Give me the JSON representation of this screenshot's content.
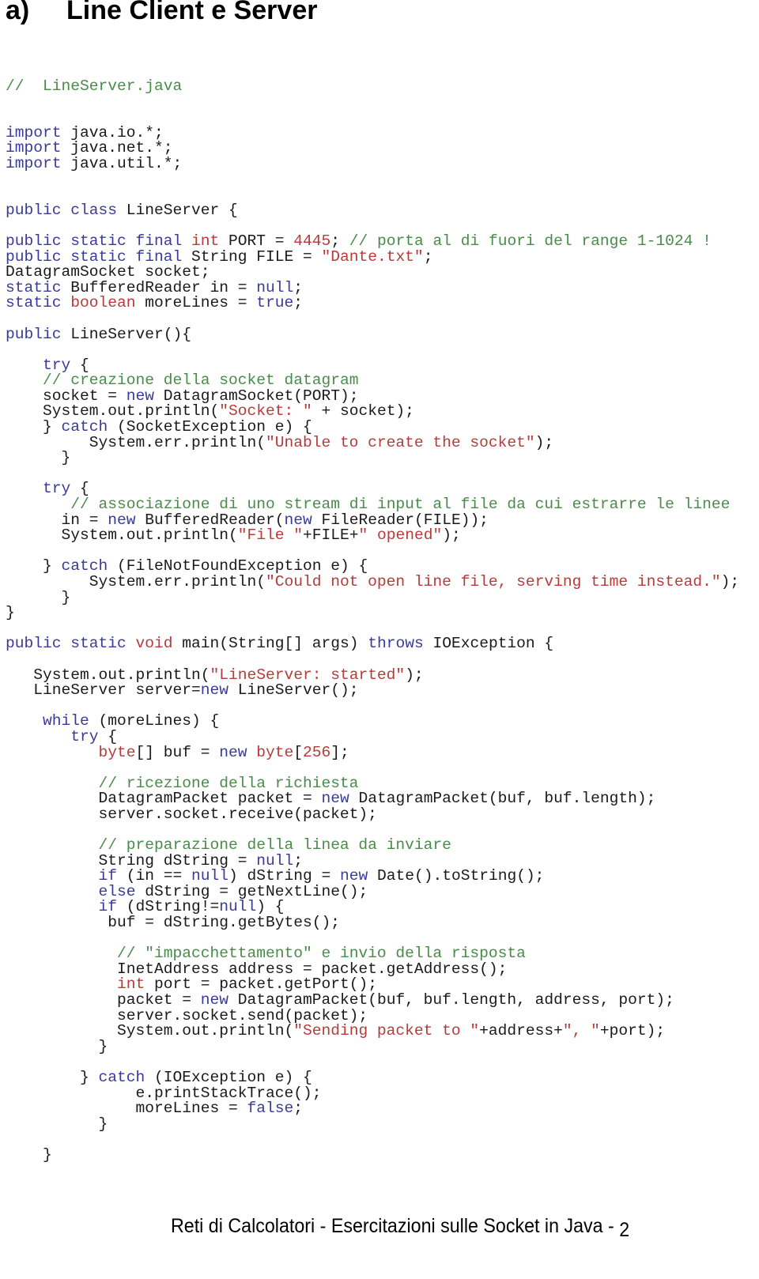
{
  "page": {
    "section_label": "a)",
    "title": "Line Client e Server",
    "footer": "Reti di Calcolatori - Esercitazioni sulle Socket in Java - ",
    "page_number": "2"
  },
  "colors": {
    "keyword": "#3a3a9a",
    "type_and_string": "#b83a3a",
    "comment": "#4a8a4a",
    "plain": "#1a1a1a"
  },
  "code": {
    "filename_comment": "//  LineServer.java",
    "lines": [
      [
        [
          "cm",
          "//  LineServer.java"
        ]
      ],
      [],
      [],
      [
        [
          "kw",
          "import"
        ],
        [
          "p",
          " java.io.*;"
        ]
      ],
      [
        [
          "kw",
          "import"
        ],
        [
          "p",
          " java.net.*;"
        ]
      ],
      [
        [
          "kw",
          "import"
        ],
        [
          "p",
          " java.util.*;"
        ]
      ],
      [],
      [],
      [
        [
          "kw",
          "public class"
        ],
        [
          "p",
          " LineServer {"
        ]
      ],
      [],
      [
        [
          "kw",
          "public static final"
        ],
        [
          "p",
          " "
        ],
        [
          "ty",
          "int"
        ],
        [
          "p",
          " PORT = "
        ],
        [
          "nu",
          "4445"
        ],
        [
          "p",
          "; "
        ],
        [
          "cm",
          "// porta al di fuori del range 1-1024 !"
        ]
      ],
      [
        [
          "kw",
          "public static final"
        ],
        [
          "p",
          " String FILE = "
        ],
        [
          "st",
          "\"Dante.txt\""
        ],
        [
          "p",
          ";"
        ]
      ],
      [
        [
          "p",
          "DatagramSocket socket;"
        ]
      ],
      [
        [
          "kw",
          "static"
        ],
        [
          "p",
          " BufferedReader in = "
        ],
        [
          "kw",
          "null"
        ],
        [
          "p",
          ";"
        ]
      ],
      [
        [
          "kw",
          "static"
        ],
        [
          "p",
          " "
        ],
        [
          "ty",
          "boolean"
        ],
        [
          "p",
          " moreLines = "
        ],
        [
          "kw",
          "true"
        ],
        [
          "p",
          ";"
        ]
      ],
      [],
      [
        [
          "kw",
          "public"
        ],
        [
          "p",
          " LineServer(){"
        ]
      ],
      [],
      [
        [
          "p",
          "    "
        ],
        [
          "kw",
          "try"
        ],
        [
          "p",
          " {"
        ]
      ],
      [
        [
          "p",
          "    "
        ],
        [
          "cm",
          "// creazione della socket datagram"
        ]
      ],
      [
        [
          "p",
          "    socket = "
        ],
        [
          "kw",
          "new"
        ],
        [
          "p",
          " DatagramSocket(PORT);"
        ]
      ],
      [
        [
          "p",
          "    System.out.println("
        ],
        [
          "st",
          "\"Socket: \""
        ],
        [
          "p",
          " + socket);"
        ]
      ],
      [
        [
          "p",
          "    } "
        ],
        [
          "kw",
          "catch"
        ],
        [
          "p",
          " (SocketException e) {"
        ]
      ],
      [
        [
          "p",
          "         System.err.println("
        ],
        [
          "st",
          "\"Unable to create the socket\""
        ],
        [
          "p",
          ");"
        ]
      ],
      [
        [
          "p",
          "      }"
        ]
      ],
      [],
      [
        [
          "p",
          "    "
        ],
        [
          "kw",
          "try"
        ],
        [
          "p",
          " {"
        ]
      ],
      [
        [
          "p",
          "       "
        ],
        [
          "cm",
          "// associazione di uno stream di input al file da cui estrarre le linee"
        ]
      ],
      [
        [
          "p",
          "      in = "
        ],
        [
          "kw",
          "new"
        ],
        [
          "p",
          " BufferedReader("
        ],
        [
          "kw",
          "new"
        ],
        [
          "p",
          " FileReader(FILE));"
        ]
      ],
      [
        [
          "p",
          "      System.out.println("
        ],
        [
          "st",
          "\"File \""
        ],
        [
          "p",
          "+FILE+"
        ],
        [
          "st",
          "\" opened\""
        ],
        [
          "p",
          ");"
        ]
      ],
      [],
      [
        [
          "p",
          "    } "
        ],
        [
          "kw",
          "catch"
        ],
        [
          "p",
          " (FileNotFoundException e) {"
        ]
      ],
      [
        [
          "p",
          "         System.err.println("
        ],
        [
          "st",
          "\"Could not open line file, serving time instead.\""
        ],
        [
          "p",
          ");"
        ]
      ],
      [
        [
          "p",
          "      }"
        ]
      ],
      [
        [
          "p",
          "}"
        ]
      ],
      [],
      [
        [
          "kw",
          "public static"
        ],
        [
          "p",
          " "
        ],
        [
          "ty",
          "void"
        ],
        [
          "p",
          " main(String[] args) "
        ],
        [
          "kw",
          "throws"
        ],
        [
          "p",
          " IOException {"
        ]
      ],
      [],
      [
        [
          "p",
          "   System.out.println("
        ],
        [
          "st",
          "\"LineServer: started\""
        ],
        [
          "p",
          ");"
        ]
      ],
      [
        [
          "p",
          "   LineServer server="
        ],
        [
          "kw",
          "new"
        ],
        [
          "p",
          " LineServer();"
        ]
      ],
      [],
      [
        [
          "p",
          "    "
        ],
        [
          "kw",
          "while"
        ],
        [
          "p",
          " (moreLines) {"
        ]
      ],
      [
        [
          "p",
          "       "
        ],
        [
          "kw",
          "try"
        ],
        [
          "p",
          " {"
        ]
      ],
      [
        [
          "p",
          "          "
        ],
        [
          "ty",
          "byte"
        ],
        [
          "p",
          "[] buf = "
        ],
        [
          "kw",
          "new"
        ],
        [
          "p",
          " "
        ],
        [
          "ty",
          "byte"
        ],
        [
          "p",
          "["
        ],
        [
          "nu",
          "256"
        ],
        [
          "p",
          "];"
        ]
      ],
      [],
      [
        [
          "p",
          "          "
        ],
        [
          "cm",
          "// ricezione della richiesta"
        ]
      ],
      [
        [
          "p",
          "          DatagramPacket packet = "
        ],
        [
          "kw",
          "new"
        ],
        [
          "p",
          " DatagramPacket(buf, buf.length);"
        ]
      ],
      [
        [
          "p",
          "          server.socket.receive(packet);"
        ]
      ],
      [],
      [
        [
          "p",
          "          "
        ],
        [
          "cm",
          "// preparazione della linea da inviare"
        ]
      ],
      [
        [
          "p",
          "          String dString = "
        ],
        [
          "kw",
          "null"
        ],
        [
          "p",
          ";"
        ]
      ],
      [
        [
          "p",
          "          "
        ],
        [
          "kw",
          "if"
        ],
        [
          "p",
          " (in == "
        ],
        [
          "kw",
          "null"
        ],
        [
          "p",
          ") dString = "
        ],
        [
          "kw",
          "new"
        ],
        [
          "p",
          " Date().toString();"
        ]
      ],
      [
        [
          "p",
          "          "
        ],
        [
          "kw",
          "else"
        ],
        [
          "p",
          " dString = getNextLine();"
        ]
      ],
      [
        [
          "p",
          "          "
        ],
        [
          "kw",
          "if"
        ],
        [
          "p",
          " (dString!="
        ],
        [
          "kw",
          "null"
        ],
        [
          "p",
          ") {"
        ]
      ],
      [
        [
          "p",
          "           buf = dString.getBytes();"
        ]
      ],
      [],
      [
        [
          "p",
          "            "
        ],
        [
          "cm",
          "// \"impacchettamento\" e invio della risposta"
        ]
      ],
      [
        [
          "p",
          "            InetAddress address = packet.getAddress();"
        ]
      ],
      [
        [
          "p",
          "            "
        ],
        [
          "ty",
          "int"
        ],
        [
          "p",
          " port = packet.getPort();"
        ]
      ],
      [
        [
          "p",
          "            packet = "
        ],
        [
          "kw",
          "new"
        ],
        [
          "p",
          " DatagramPacket(buf, buf.length, address, port);"
        ]
      ],
      [
        [
          "p",
          "            server.socket.send(packet);"
        ]
      ],
      [
        [
          "p",
          "            System.out.println("
        ],
        [
          "st",
          "\"Sending packet to \""
        ],
        [
          "p",
          "+address+"
        ],
        [
          "st",
          "\", \""
        ],
        [
          "p",
          "+port);"
        ]
      ],
      [
        [
          "p",
          "          }"
        ]
      ],
      [],
      [
        [
          "p",
          "        } "
        ],
        [
          "kw",
          "catch"
        ],
        [
          "p",
          " (IOException e) {"
        ]
      ],
      [
        [
          "p",
          "              e.printStackTrace();"
        ]
      ],
      [
        [
          "p",
          "              moreLines = "
        ],
        [
          "kw",
          "false"
        ],
        [
          "p",
          ";"
        ]
      ],
      [
        [
          "p",
          "          }"
        ]
      ],
      [],
      [
        [
          "p",
          "    }"
        ]
      ]
    ]
  }
}
